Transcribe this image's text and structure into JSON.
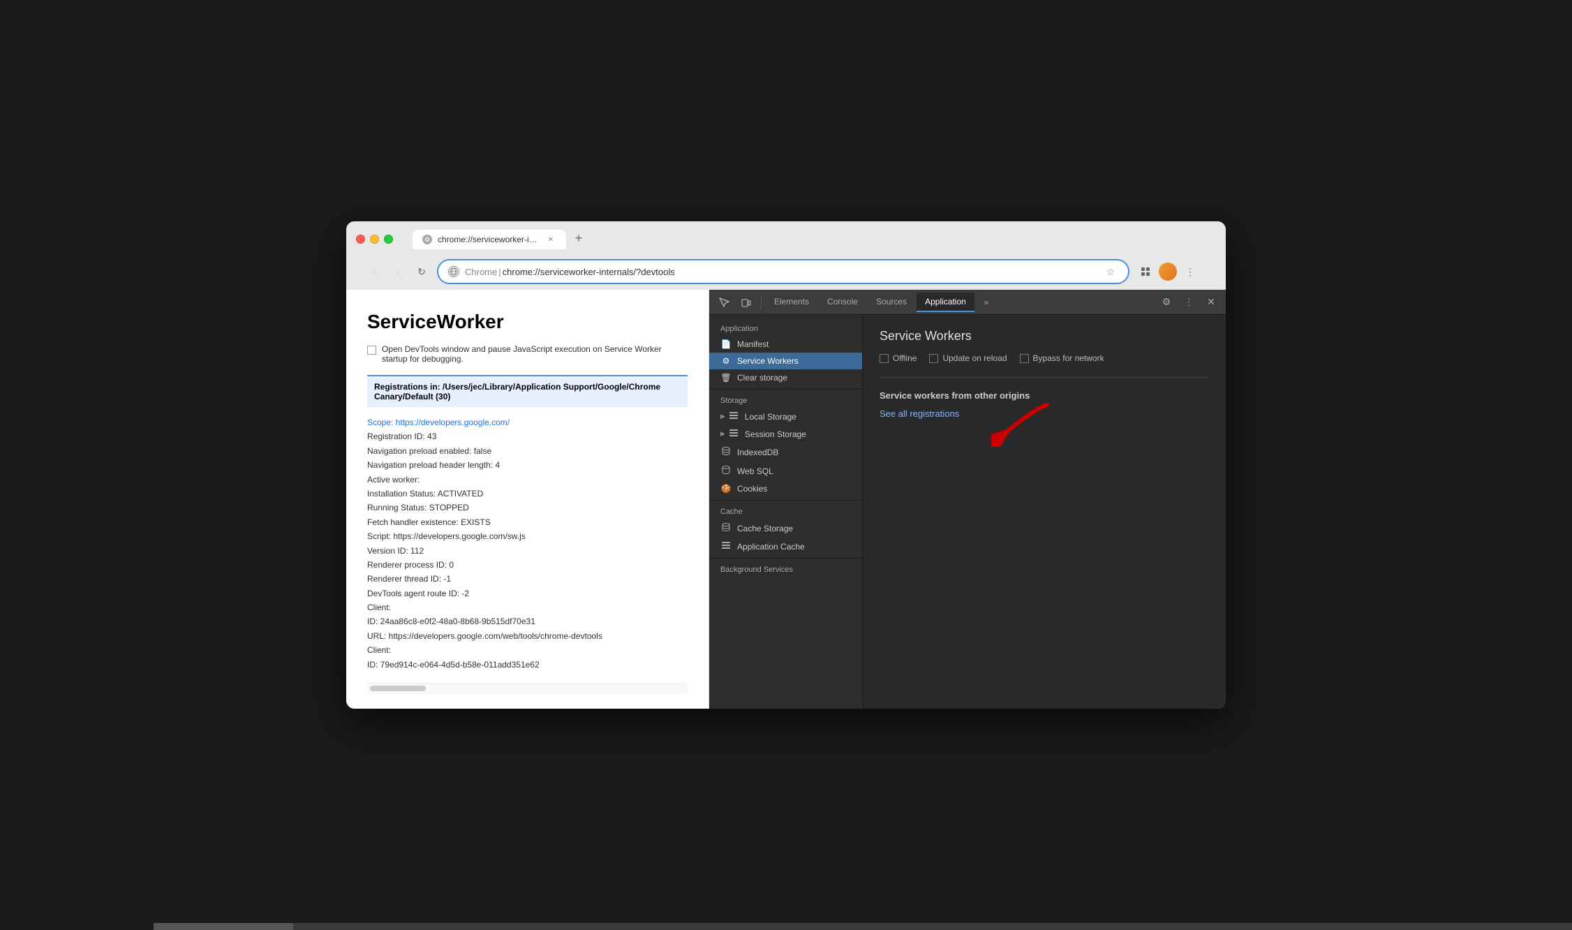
{
  "browser": {
    "tab_title": "chrome://serviceworker-intern...",
    "tab_icon": "⚙",
    "url_origin": "Chrome",
    "url_separator": "|",
    "url_full": "chrome://serviceworker-internals/?devtools",
    "new_tab_label": "+",
    "nav_back": "‹",
    "nav_forward": "›",
    "reload": "↺"
  },
  "page": {
    "title": "ServiceWorker",
    "checkbox_label": "Open DevTools window and pause JavaScript execution on Service Worker startup for debugging.",
    "registration_heading": "Registrations in: /Users/jec/Library/Application Support/Google/Chrome Canary/Default (30)",
    "scope_label": "Scope:",
    "scope_url": "https://developers.google.com/",
    "registration_id": "Registration ID: 43",
    "nav_preload": "Navigation preload enabled: false",
    "nav_preload_header": "Navigation preload header length: 4",
    "active_worker": "Active worker:",
    "installation_status": "    Installation Status: ACTIVATED",
    "running_status": "    Running Status: STOPPED",
    "fetch_handler": "    Fetch handler existence: EXISTS",
    "script": "    Script: https://developers.google.com/sw.js",
    "version_id": "    Version ID: 112",
    "renderer_process": "    Renderer process ID: 0",
    "renderer_thread": "    Renderer thread ID: -1",
    "devtools_agent": "    DevTools agent route ID: -2",
    "client_label1": "Client:",
    "client_id1": "    ID: 24aa86c8-e0f2-48a0-8b68-9b515df70e31",
    "client_url1": "    URL: https://developers.google.com/web/tools/chrome-devtools",
    "client_label2": "Client:",
    "client_id2": "    ID: 79ed914c-e064-4d5d-b58e-011add351e62"
  },
  "devtools": {
    "tabs": [
      {
        "label": "Elements",
        "active": false
      },
      {
        "label": "Console",
        "active": false
      },
      {
        "label": "Sources",
        "active": false
      },
      {
        "label": "Application",
        "active": true
      }
    ],
    "more_tabs": "»",
    "sidebar": {
      "application_heading": "Application",
      "items_application": [
        {
          "label": "Manifest",
          "icon": "📄",
          "active": false
        },
        {
          "label": "Service Workers",
          "icon": "⚙",
          "active": true
        },
        {
          "label": "Clear storage",
          "icon": "🗑",
          "active": false
        }
      ],
      "storage_heading": "Storage",
      "items_storage": [
        {
          "label": "Local Storage",
          "icon": "≡",
          "has_arrow": true
        },
        {
          "label": "Session Storage",
          "icon": "≡",
          "has_arrow": true
        },
        {
          "label": "IndexedDB",
          "icon": "🗄"
        },
        {
          "label": "Web SQL",
          "icon": "🗄"
        },
        {
          "label": "Cookies",
          "icon": "🍪"
        }
      ],
      "cache_heading": "Cache",
      "items_cache": [
        {
          "label": "Cache Storage",
          "icon": "🗄"
        },
        {
          "label": "Application Cache",
          "icon": "≡"
        }
      ],
      "bg_services_heading": "Background Services"
    },
    "main": {
      "title": "Service Workers",
      "offline_label": "Offline",
      "update_on_reload_label": "Update on reload",
      "bypass_network_label": "Bypass for network",
      "other_origins_title": "Service workers from other origins",
      "see_all_link": "See all registrations"
    }
  }
}
